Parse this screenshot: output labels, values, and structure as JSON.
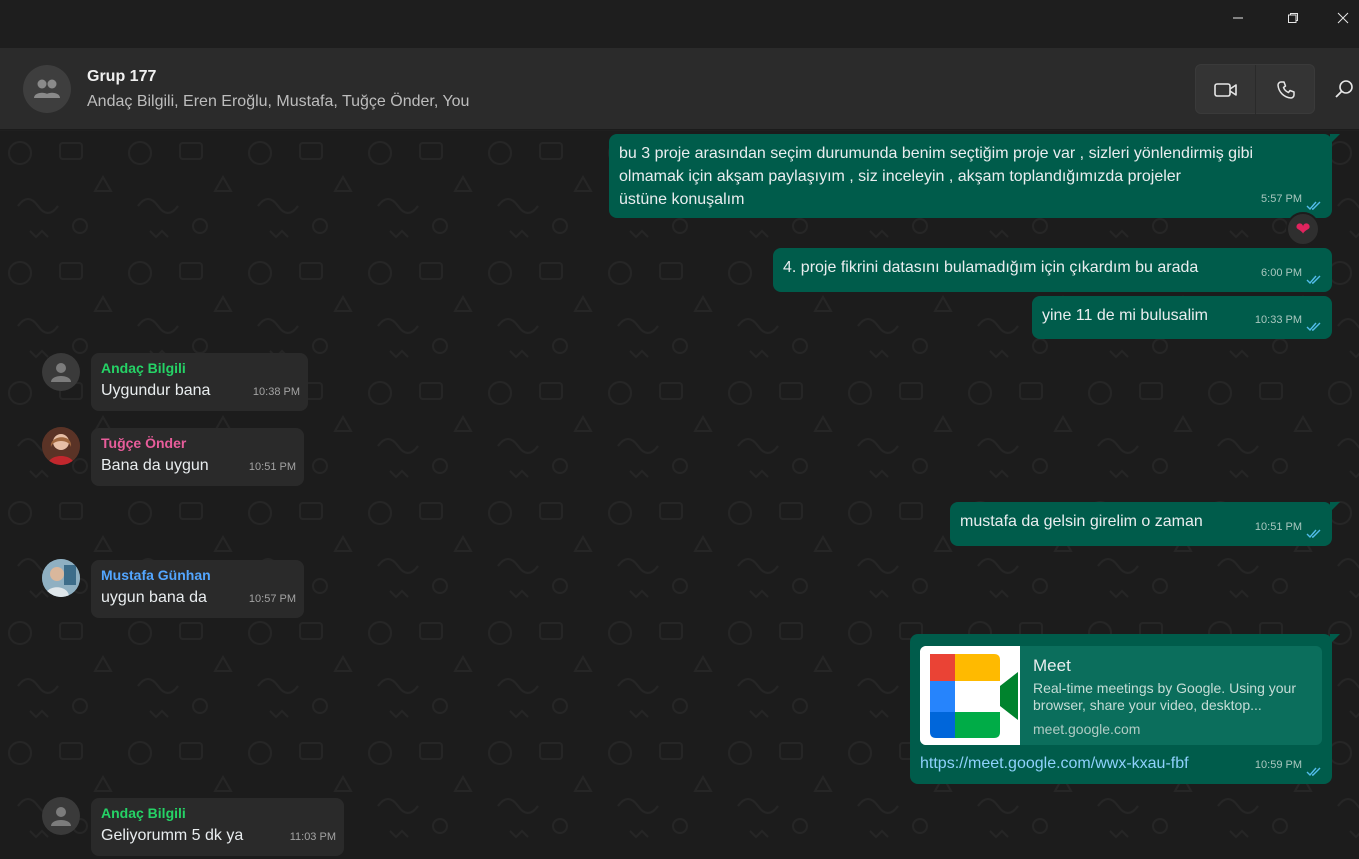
{
  "chat": {
    "title": "Grup 177",
    "members": "Andaç Bilgili, Eren Eroğlu, Mustafa, Tuğçe Önder, You"
  },
  "messages": {
    "m1": {
      "text_lines": [
        "bu 3 proje arasından seçim durumunda benim seçtiğim proje var , sizleri yönlendirmiş gibi",
        "olmamak için akşam paylaşıyım , siz inceleyin , akşam toplandığımızda projeler",
        "üstüne konuşalım"
      ],
      "time": "5:57 PM",
      "reaction": "❤"
    },
    "m2": {
      "text": "4. proje fikrini datasını bulamadığım için çıkardım bu arada",
      "time": "6:00 PM"
    },
    "m3": {
      "text": "yine 11 de mi bulusalim",
      "time": "10:33 PM"
    },
    "m4": {
      "sender": "Andaç Bilgili",
      "text": "Uygundur bana",
      "time": "10:38 PM"
    },
    "m5": {
      "sender": "Tuğçe Önder",
      "text": "Bana da uygun",
      "time": "10:51 PM"
    },
    "m6": {
      "text": "mustafa da gelsin girelim o zaman",
      "time": "10:51 PM"
    },
    "m7": {
      "sender": "Mustafa Günhan",
      "text": "uygun bana da",
      "time": "10:57 PM"
    },
    "m8": {
      "link_title": "Meet",
      "link_desc": "Real-time meetings by Google. Using your browser, share your video, desktop...",
      "link_domain": "meet.google.com",
      "url": "https://meet.google.com/wwx-kxau-fbf",
      "time": "10:59 PM"
    },
    "m9": {
      "sender": "Andaç Bilgili",
      "text": "Geliyorumm 5 dk ya",
      "time": "11:03 PM"
    }
  },
  "colors": {
    "outgoing_bubble": "#005c4b",
    "incoming_bubble": "#2a2a2a",
    "read_ticks": "#53bdeb",
    "sender_andac": "#25d366",
    "sender_tugce": "#e85d9b",
    "sender_mustafa": "#53a6ff"
  },
  "icons": {
    "window": [
      "minimize-icon",
      "maximize-icon",
      "close-icon"
    ],
    "header": [
      "group-avatar-icon",
      "video-call-icon",
      "voice-call-icon",
      "search-icon"
    ]
  }
}
